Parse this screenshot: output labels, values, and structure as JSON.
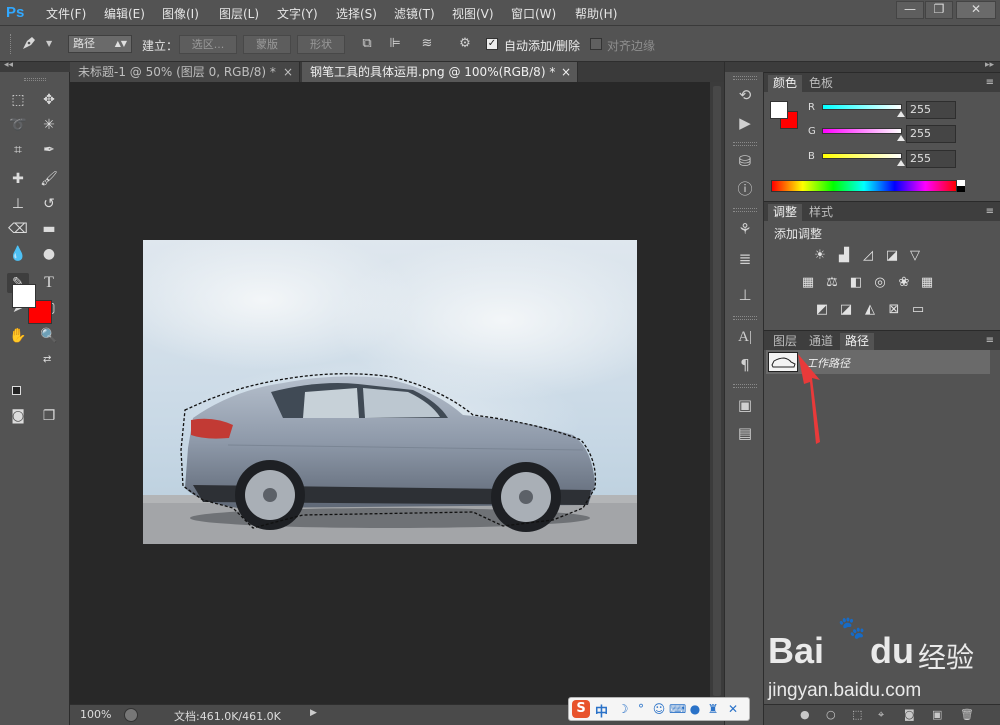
{
  "colors": {
    "foreground": "#ffffff",
    "background": "#ff0000",
    "highlight_arrow": "#e83a3a"
  },
  "app": {
    "logo": "Ps"
  },
  "menubar": {
    "items": [
      "文件(F)",
      "编辑(E)",
      "图像(I)",
      "图层(L)",
      "文字(Y)",
      "选择(S)",
      "滤镜(T)",
      "视图(V)",
      "窗口(W)",
      "帮助(H)"
    ],
    "window_buttons": {
      "minimize": "—",
      "restore": "❐",
      "close": "✕"
    }
  },
  "options": {
    "tool_icon": "pen-tool-icon",
    "mode_value": "路径",
    "make_label": "建立：",
    "selection_button": "选区...",
    "mask_button": "蒙版",
    "shape_button": "形状",
    "auto_add_delete_label": "自动添加/删除",
    "auto_add_delete_checked": true,
    "align_edges_label": "对齐边缘",
    "align_edges_checked": false
  },
  "documents": {
    "tabs": [
      {
        "title": "未标题-1 @ 50% (图层 0, RGB/8) *",
        "active": false
      },
      {
        "title": "钢笔工具的具体运用.png @ 100%(RGB/8) *",
        "active": true
      }
    ],
    "tab_close": "×"
  },
  "status": {
    "zoom": "100%",
    "doc_info": "文档:461.0K/461.0K"
  },
  "color_panel": {
    "tabs": [
      "颜色",
      "色板"
    ],
    "channels": [
      {
        "label": "R",
        "value": "255"
      },
      {
        "label": "G",
        "value": "255"
      },
      {
        "label": "B",
        "value": "255"
      }
    ]
  },
  "adjustments_panel": {
    "tabs": [
      "调整",
      "样式"
    ],
    "heading": "添加调整"
  },
  "paths_panel": {
    "tabs": [
      "图层",
      "通道",
      "路径"
    ],
    "active_tab": "路径",
    "paths": [
      {
        "name": "工作路径"
      }
    ]
  },
  "ime": {
    "label": "中"
  },
  "watermark": {
    "brand": "Bai",
    "brand2": "du",
    "cn": "经验",
    "url": "jingyan.baidu.com"
  }
}
